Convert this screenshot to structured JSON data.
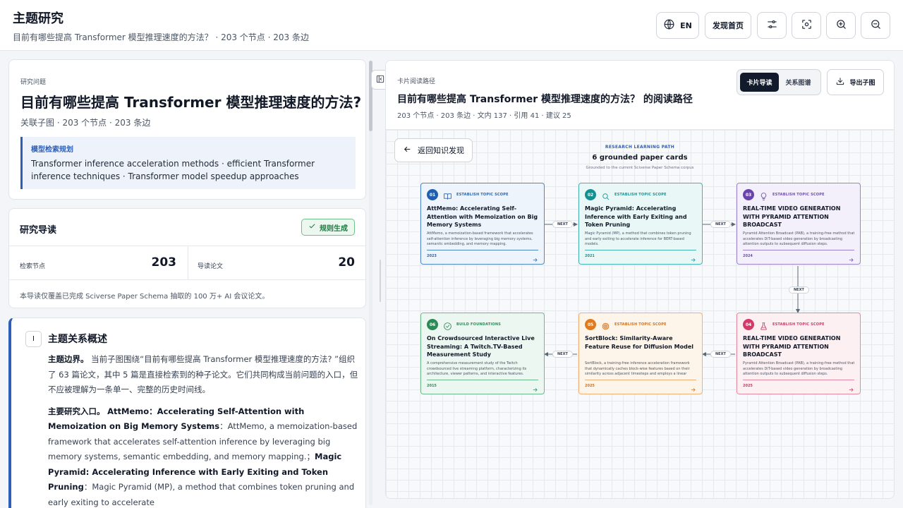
{
  "header": {
    "title": "主题研究",
    "subtitle": "目前有哪些提高 Transformer 模型推理速度的方法？ · 203 个节点 · 203 条边",
    "lang_label": "EN",
    "home_label": "发现首页"
  },
  "question": {
    "kicker": "研究问题",
    "title": "目前有哪些提高 Transformer 模型推理速度的方法?",
    "meta": "关联子图 · 203 个节点 · 203 条边",
    "plan_label": "模型检索规划",
    "plan_text": "Transformer inference acceleration methods · efficient Transformer inference techniques · Transformer model speedup approaches"
  },
  "guide": {
    "title": "研究导读",
    "badge": "规则生成",
    "stats": [
      {
        "label": "检索节点",
        "value": "203"
      },
      {
        "label": "导读论文",
        "value": "20"
      }
    ],
    "note": "本导读仅覆盖已完成 Sciverse Paper Schema 抽取的 100 万+ AI 会议论文。"
  },
  "overview": {
    "index": "I",
    "title": "主题关系概述",
    "p1_bold": "主题边界。",
    "p1_text": "当前子图围绕“目前有哪些提高 Transformer 模型推理速度的方法? ”组织了 63 篇论文，其中 5 篇是直接检索到的种子论文。它们共同构成当前问题的入口，但不应被理解为一条单一、完整的历史时间线。",
    "p2_bold": "主要研究入口。",
    "p2_b1": "AttMemo：Accelerating Self-Attention with Memoization on Big Memory Systems",
    "p2_t1": "：AttMemo, a memoization-based framework that accelerates self-attention inference by leveraging big memory systems, semantic embedding, and memory mapping.；",
    "p2_b2": "Magic Pyramid: Accelerating Inference with Early Exiting and Token Pruning",
    "p2_t2": "：Magic Pyramid (MP), a method that combines token pruning and early exiting to accelerate"
  },
  "right": {
    "kicker": "卡片阅读路径",
    "title": "目前有哪些提高 Transformer 模型推理速度的方法？ 的阅读路径",
    "meta": "203 个节点 · 203 条边 · 文内 137 · 引用 41 · 建议 25",
    "tabs": [
      "卡片导读",
      "关系图谱"
    ],
    "export_label": "导出子图",
    "back_label": "返回知识发现",
    "path_kicker": "RESEARCH LEARNING PATH",
    "path_title": "6 grounded paper cards",
    "path_sub": "Grounded to the current Sciverse Paper Schema corpus",
    "next_label": "NEXT"
  },
  "cards": [
    {
      "num": "01",
      "stage": "ESTABLISH TOPIC SCOPE",
      "icon": "book-icon",
      "title": "AttMemo: Accelerating Self-Attention with Memoization on Big Memory Systems",
      "desc": "AttMemo, a memoization-based framework that accelerates self-attention inference by leveraging big memory systems, semantic embedding, and memory mapping.",
      "year": "2023",
      "theme": "blue"
    },
    {
      "num": "02",
      "stage": "ESTABLISH TOPIC SCOPE",
      "icon": "search-icon",
      "title": "Magic Pyramid: Accelerating Inference with Early Exiting and Token Pruning",
      "desc": "Magic Pyramid (MP), a method that combines token pruning and early exiting to accelerate inference for BERT-based models.",
      "year": "2021",
      "theme": "teal"
    },
    {
      "num": "03",
      "stage": "ESTABLISH TOPIC SCOPE",
      "icon": "lightbulb-icon",
      "title": "REAL-TIME VIDEO GENERATION WITH PYRAMID ATTENTION BROADCAST",
      "desc": "Pyramid Attention Broadcast (PAB), a training-free method that accelerates DiT-based video generation by broadcasting attention outputs to subsequent diffusion steps.",
      "year": "2024",
      "theme": "purple"
    },
    {
      "num": "04",
      "stage": "ESTABLISH TOPIC SCOPE",
      "icon": "flask-icon",
      "title": "REAL-TIME VIDEO GENERATION WITH PYRAMID ATTENTION BROADCAST",
      "desc": "Pyramid Attention Broadcast (PAB), a training-free method that accelerates DiT-based video generation by broadcasting attention outputs to subsequent diffusion steps.",
      "year": "2025",
      "theme": "pink"
    },
    {
      "num": "05",
      "stage": "ESTABLISH TOPIC SCOPE",
      "icon": "target-icon",
      "title": "SortBlock: Similarity-Aware Feature Reuse for Diffusion Model",
      "desc": "SortBlock, a training-free inference acceleration framework that dynamically caches block-wise features based on their similarity across adjacent timesteps and employs a linear prediction mechanism to reduce accumulated errors.",
      "year": "2025",
      "theme": "orange"
    },
    {
      "num": "06",
      "stage": "BUILD FOUNDATIONS",
      "icon": "check-circle-icon",
      "title": "On Crowdsourced Interactive Live Streaming: A Twitch.TV-Based Measurement Study",
      "desc": "A comprehensive measurement study of the Twitch crowdsourced live streaming platform, characterizing its architecture, viewer patterns, and interactive features.",
      "year": "2015",
      "theme": "green"
    }
  ]
}
